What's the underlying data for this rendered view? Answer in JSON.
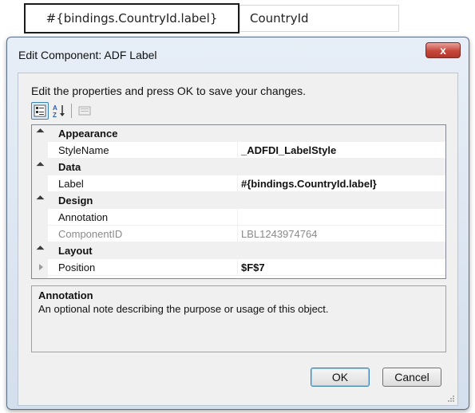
{
  "background": {
    "cell_formula": "#{bindings.CountryId.label}",
    "cell_label": "CountryId"
  },
  "dialog": {
    "title": "Edit Component: ADF Label",
    "close_label": "x",
    "instructions": "Edit the properties and press OK to save your changes."
  },
  "toolbar": {
    "categorized_icon": "categorized-view-icon",
    "alphabetical_icon": "sort-az-icon",
    "property_pages_icon": "property-pages-icon"
  },
  "grid": {
    "appearance": {
      "label": "Appearance",
      "stylename_name": "StyleName",
      "stylename_value": "_ADFDI_LabelStyle"
    },
    "data": {
      "label": "Data",
      "label_name": "Label",
      "label_value": "#{bindings.CountryId.label}"
    },
    "design": {
      "label": "Design",
      "annotation_name": "Annotation",
      "annotation_value": "",
      "componentid_name": "ComponentID",
      "componentid_value": "LBL1243974764"
    },
    "layout": {
      "label": "Layout",
      "position_name": "Position",
      "position_value": "$F$7"
    }
  },
  "description": {
    "title": "Annotation",
    "text": "An optional note describing the purpose or usage of this object."
  },
  "buttons": {
    "ok": "OK",
    "cancel": "Cancel"
  },
  "colors": {
    "title_bar": "#d4dfed",
    "close_button": "#c7463b",
    "accent": "#3c7fb1"
  }
}
